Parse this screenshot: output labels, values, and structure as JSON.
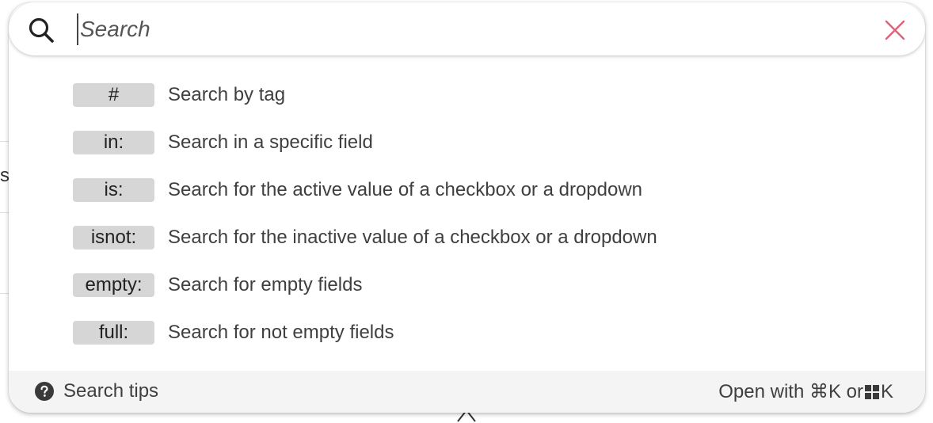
{
  "search": {
    "placeholder": "Search",
    "value": ""
  },
  "tips": [
    {
      "token": "#",
      "description": "Search by tag"
    },
    {
      "token": "in:",
      "description": "Search in a specific field"
    },
    {
      "token": "is:",
      "description": "Search for the active value of a checkbox or a dropdown"
    },
    {
      "token": "isnot:",
      "description": "Search for the inactive value of a checkbox or a dropdown"
    },
    {
      "token": "empty:",
      "description": "Search for empty fields"
    },
    {
      "token": "full:",
      "description": "Search for not empty fields"
    }
  ],
  "footer": {
    "tips_label": "Search tips",
    "shortcut_prefix": "Open with ⌘K or",
    "shortcut_suffix": "K"
  },
  "background": {
    "partial_letter": "s"
  },
  "colors": {
    "close_icon": "#e0607a",
    "badge_bg": "#d6d6d6",
    "footer_bg": "#f4f4f4"
  },
  "icons": {
    "search": "search-icon",
    "close": "close-icon",
    "help": "question-circle-icon",
    "windows": "windows-logo-icon"
  }
}
